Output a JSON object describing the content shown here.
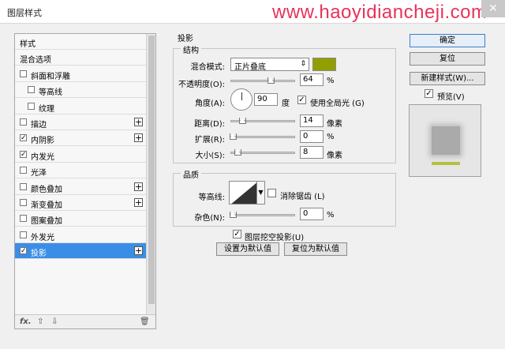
{
  "window": {
    "title": "图层样式",
    "watermark": "www.haoyidiancheji.com",
    "close": "✕"
  },
  "colors": {
    "shadow_color": "#8fa000",
    "selected_bg": "#3a8ee6"
  },
  "left_panel": {
    "items": [
      {
        "label": "样式",
        "checkbox": false,
        "checked": false,
        "plus": false,
        "indent": 0
      },
      {
        "label": "混合选项",
        "checkbox": false,
        "checked": false,
        "plus": false,
        "indent": 0
      },
      {
        "label": "斜面和浮雕",
        "checkbox": true,
        "checked": false,
        "plus": false,
        "indent": 0
      },
      {
        "label": "等高线",
        "checkbox": true,
        "checked": false,
        "plus": false,
        "indent": 1
      },
      {
        "label": "纹理",
        "checkbox": true,
        "checked": false,
        "plus": false,
        "indent": 1
      },
      {
        "label": "描边",
        "checkbox": true,
        "checked": false,
        "plus": true,
        "indent": 0
      },
      {
        "label": "内阴影",
        "checkbox": true,
        "checked": true,
        "plus": true,
        "indent": 0
      },
      {
        "label": "内发光",
        "checkbox": true,
        "checked": true,
        "plus": false,
        "indent": 0
      },
      {
        "label": "光泽",
        "checkbox": true,
        "checked": false,
        "plus": false,
        "indent": 0
      },
      {
        "label": "颜色叠加",
        "checkbox": true,
        "checked": false,
        "plus": true,
        "indent": 0
      },
      {
        "label": "渐变叠加",
        "checkbox": true,
        "checked": false,
        "plus": true,
        "indent": 0
      },
      {
        "label": "图案叠加",
        "checkbox": true,
        "checked": false,
        "plus": false,
        "indent": 0
      },
      {
        "label": "外发光",
        "checkbox": true,
        "checked": false,
        "plus": false,
        "indent": 0
      },
      {
        "label": "投影",
        "checkbox": true,
        "checked": true,
        "plus": true,
        "indent": 0,
        "selected": true
      }
    ],
    "tools": {
      "fx": "fx.",
      "up": "⇧",
      "down": "⇩",
      "trash": "🗑"
    },
    "check_mark": "✓",
    "plus_glyph": "+"
  },
  "drop_shadow": {
    "section_title": "投影",
    "structure_title": "结构",
    "blend_mode_label": "混合模式:",
    "blend_mode_value": "正片叠底",
    "opacity_label": "不透明度(O):",
    "opacity_value": "64",
    "opacity_unit": "%",
    "opacity_level": 0.64,
    "angle_label": "角度(A):",
    "angle_value": "90",
    "angle_unit": "度",
    "global_light_label": "使用全局光 (G)",
    "global_light_checked": true,
    "distance_label": "距离(D):",
    "distance_value": "14",
    "distance_unit": "像素",
    "spread_label": "扩展(R):",
    "spread_value": "0",
    "spread_unit": "%",
    "size_label": "大小(S):",
    "size_value": "8",
    "size_unit": "像素",
    "quality_title": "品质",
    "contour_label": "等高线:",
    "antialias_label": "消除锯齿 (L)",
    "antialias_checked": false,
    "noise_label": "杂色(N):",
    "noise_value": "0",
    "noise_unit": "%",
    "knockout_label": "图层挖空投影(U)",
    "knockout_checked": true,
    "make_default_label": "设置为默认值",
    "reset_default_label": "复位为默认值"
  },
  "right_buttons": {
    "ok": "确定",
    "reset": "复位",
    "new_style": "新建样式(W)...",
    "preview_label": "预览(V)",
    "preview_checked": true
  }
}
